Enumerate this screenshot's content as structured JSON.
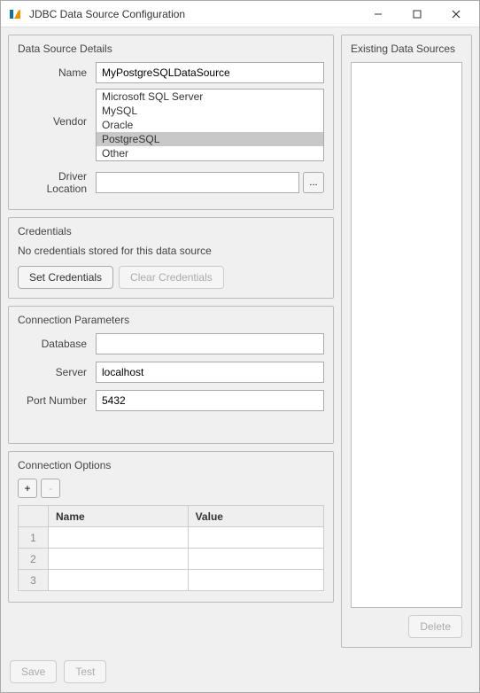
{
  "window": {
    "title": "JDBC Data Source Configuration"
  },
  "dataSourceDetails": {
    "title": "Data Source Details",
    "nameLabel": "Name",
    "nameValue": "MyPostgreSQLDataSource",
    "vendorLabel": "Vendor",
    "vendors": [
      "Microsoft SQL Server",
      "MySQL",
      "Oracle",
      "PostgreSQL",
      "Other"
    ],
    "selectedVendor": "PostgreSQL",
    "driverLabel": "Driver Location",
    "driverValue": "",
    "browseLabel": "..."
  },
  "credentials": {
    "title": "Credentials",
    "message": "No credentials stored for this data source",
    "setLabel": "Set Credentials",
    "clearLabel": "Clear Credentials"
  },
  "connectionParams": {
    "title": "Connection Parameters",
    "databaseLabel": "Database",
    "databaseValue": "",
    "serverLabel": "Server",
    "serverValue": "localhost",
    "portLabel": "Port Number",
    "portValue": "5432"
  },
  "connectionOptions": {
    "title": "Connection Options",
    "addLabel": "+",
    "removeLabel": "-",
    "headers": {
      "name": "Name",
      "value": "Value"
    },
    "rows": [
      {
        "num": "1",
        "name": "",
        "value": ""
      },
      {
        "num": "2",
        "name": "",
        "value": ""
      },
      {
        "num": "3",
        "name": "",
        "value": ""
      }
    ]
  },
  "existing": {
    "title": "Existing Data Sources",
    "deleteLabel": "Delete"
  },
  "footer": {
    "saveLabel": "Save",
    "testLabel": "Test"
  }
}
